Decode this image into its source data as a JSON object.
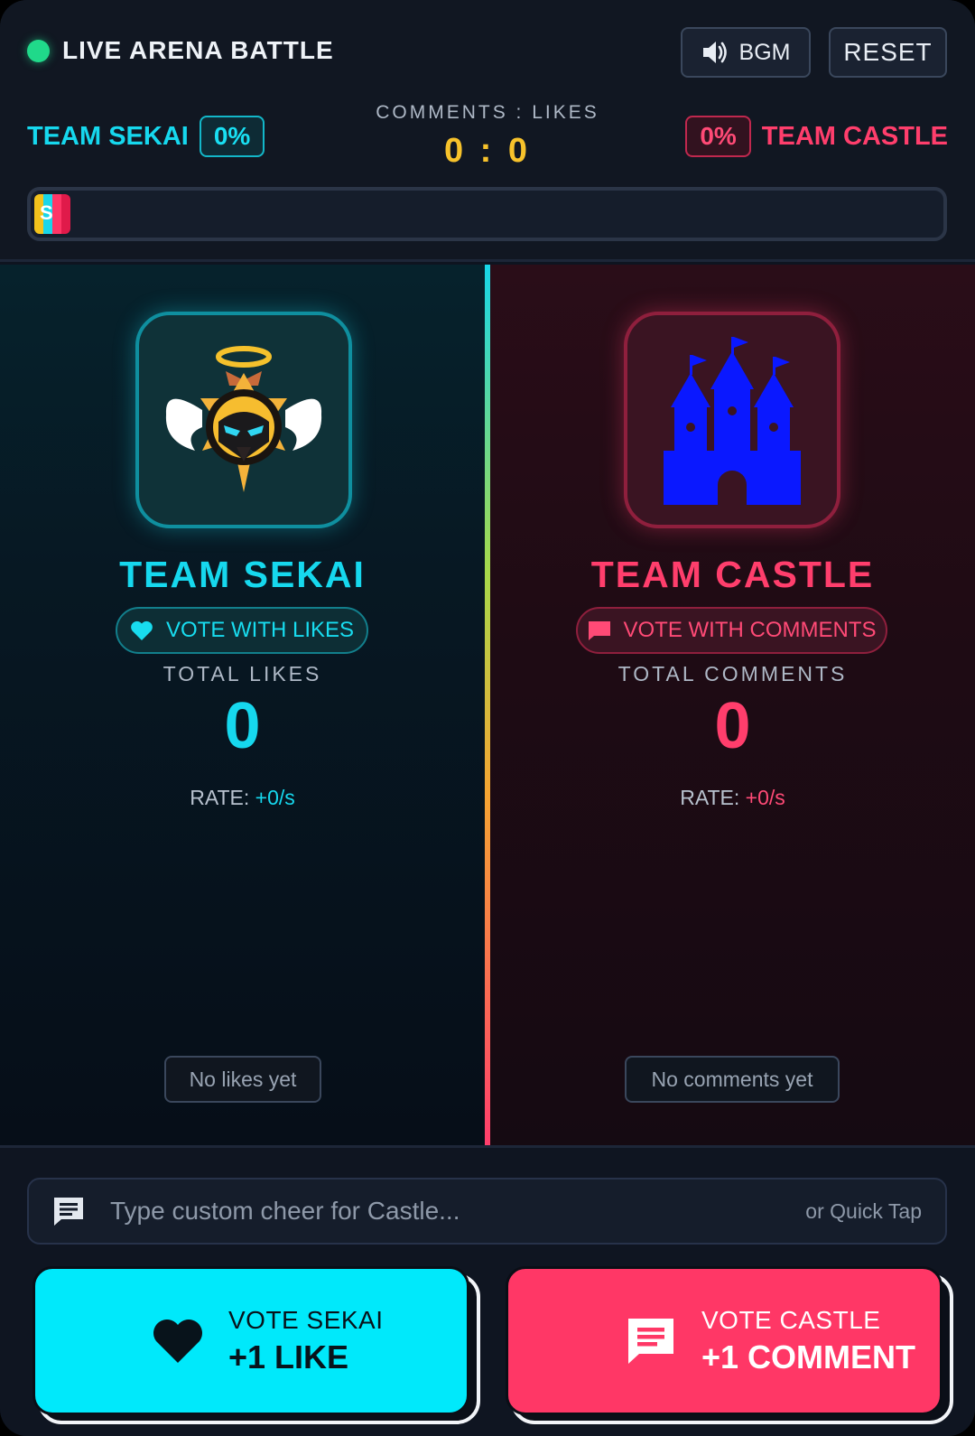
{
  "header": {
    "live_label": "LIVE ARENA BATTLE",
    "bgm_label": "BGM",
    "reset_label": "RESET",
    "left_team": "TEAM SEKAI",
    "left_pct": "0%",
    "right_team": "TEAM CASTLE",
    "right_pct": "0%",
    "score_caption": "COMMENTS : LIKES",
    "score": "0 : 0",
    "bar_letter": "S"
  },
  "sekai": {
    "name": "TEAM SEKAI",
    "vote_mode": "VOTE WITH LIKES",
    "total_label": "TOTAL LIKES",
    "total": "0",
    "rate_label": "RATE:",
    "rate_value": "+0/s",
    "empty": "No likes yet"
  },
  "castle": {
    "name": "TEAM CASTLE",
    "vote_mode": "VOTE WITH COMMENTS",
    "total_label": "TOTAL COMMENTS",
    "total": "0",
    "rate_label": "RATE:",
    "rate_value": "+0/s",
    "empty": "No comments yet"
  },
  "cheer": {
    "placeholder": "Type custom cheer for Castle...",
    "quick_tap": "or Quick Tap"
  },
  "buttons": {
    "sekai_small": "VOTE SEKAI",
    "sekai_big": "+1 LIKE",
    "castle_small": "VOTE CASTLE",
    "castle_big": "+1 COMMENT"
  },
  "colors": {
    "cyan": "#16d8ee",
    "red": "#ff3e6c",
    "gold": "#f7c22b",
    "live_green": "#20d98a"
  },
  "icons": [
    "speaker-icon",
    "heart-icon",
    "comment-icon",
    "chat-icon",
    "sekai-emblem-icon",
    "castle-icon"
  ]
}
